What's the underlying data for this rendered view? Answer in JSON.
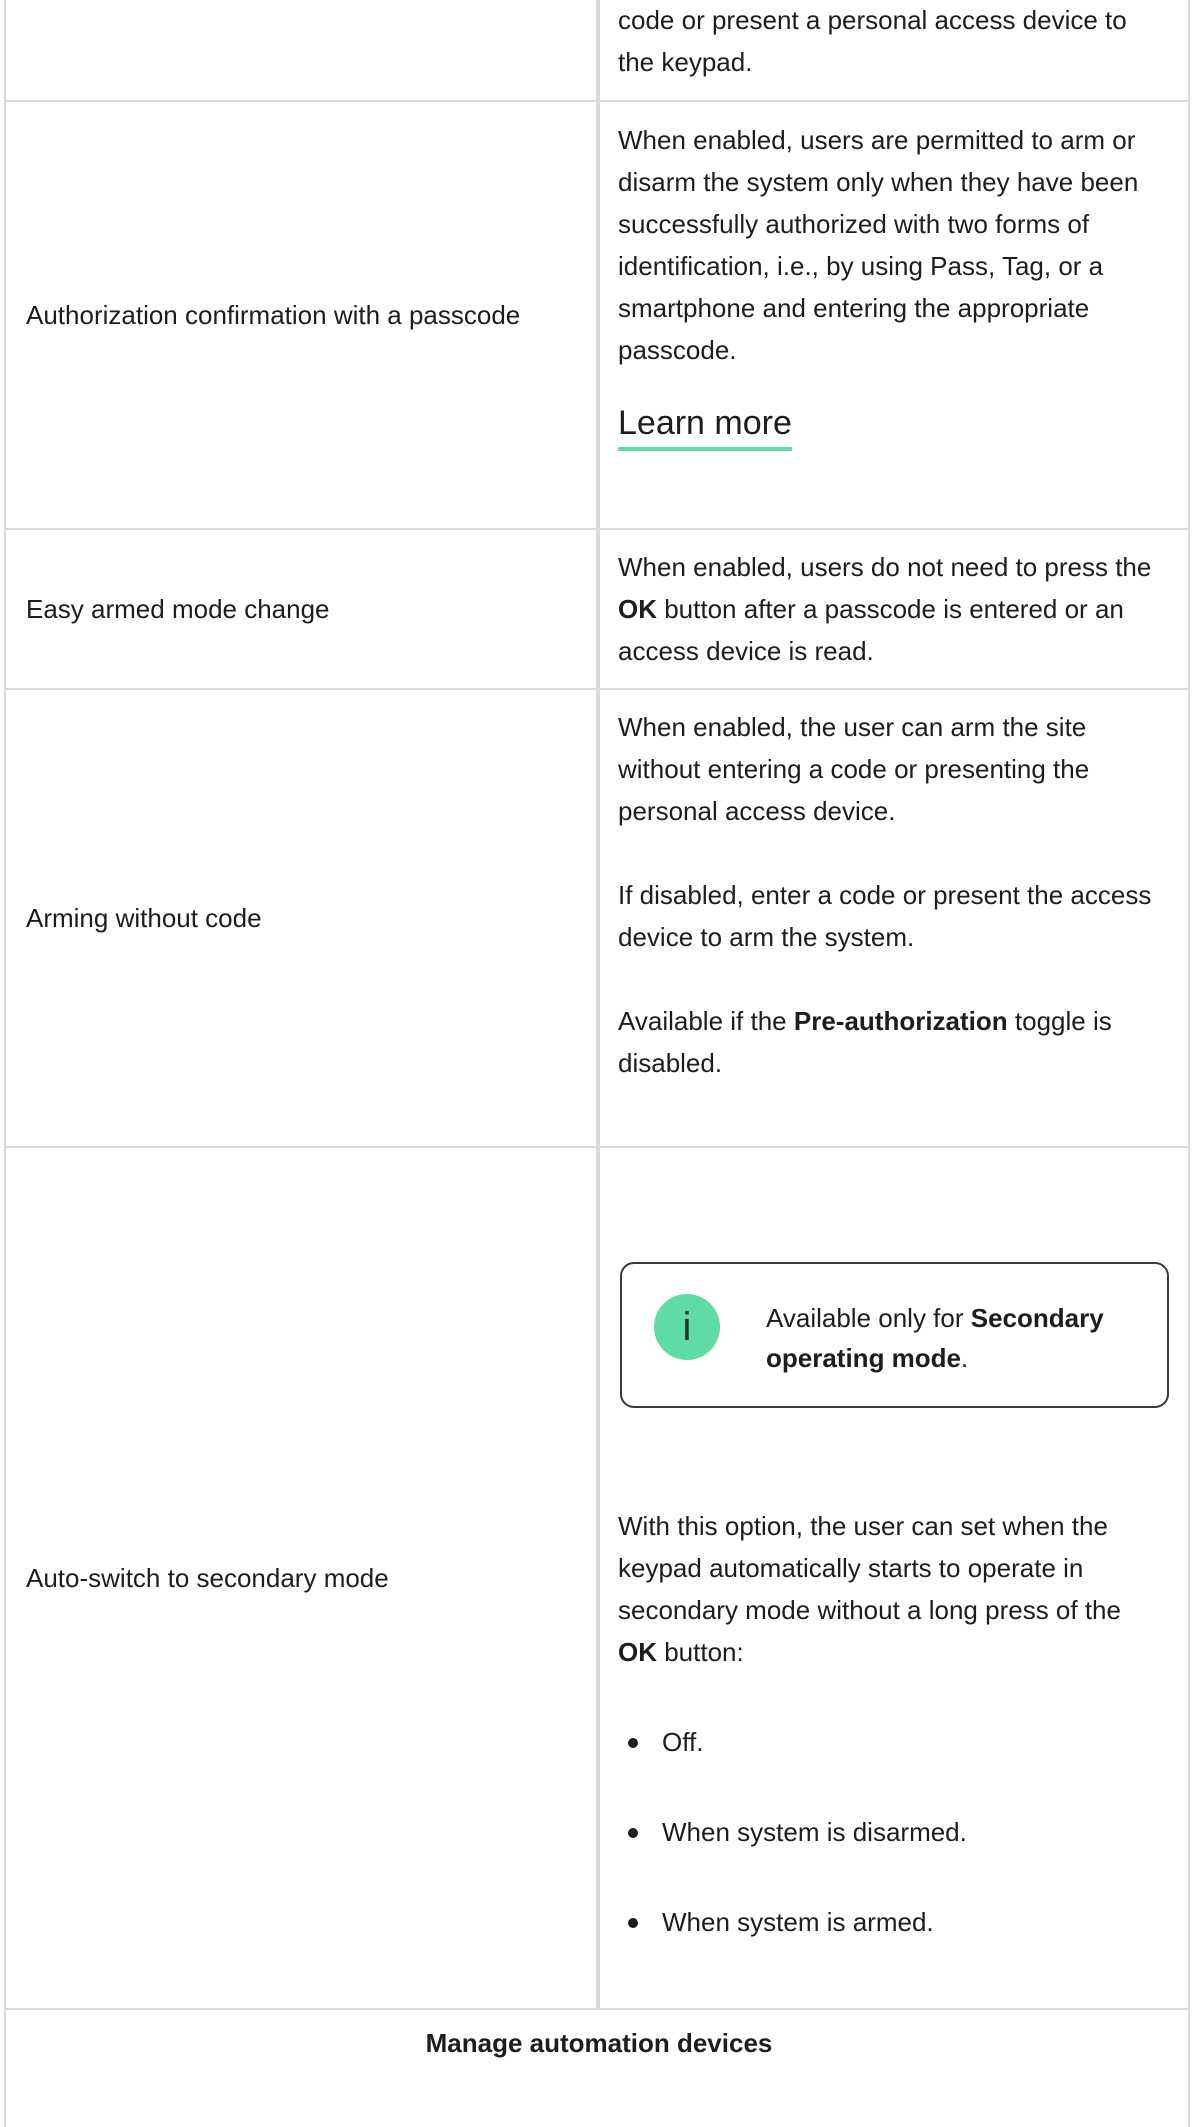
{
  "rows": {
    "top": {
      "description": [
        "code or present a personal access device to",
        "the keypad."
      ]
    },
    "auth_confirm": {
      "setting": "Authorization confirmation with a passcode",
      "description": "When enabled, users are permitted to arm or disarm the system only when they have been successfully authorized with two forms of identification, i.e., by using Pass, Tag, or a smartphone and entering the appropriate passcode.",
      "link": "Learn more"
    },
    "easy_armed": {
      "setting": "Easy armed mode change",
      "desc_before": "When enabled, users do not need to press the ",
      "desc_bold": "OK",
      "desc_after": " button after a passcode is entered or an access device is read."
    },
    "arming_without_code": {
      "setting": "Arming without code",
      "p1": "When enabled, the user can arm the site without entering a code or presenting the personal access device.",
      "p2": "If disabled, enter a code or present the access device to arm the system.",
      "p3_before": "Available if the ",
      "p3_bold": "Pre-authorization",
      "p3_after": " toggle is disabled."
    },
    "auto_switch": {
      "setting": "Auto-switch to secondary mode",
      "note_before": "Available only for ",
      "note_bold": "Secondary operating mode",
      "note_after": ".",
      "info_icon": "i",
      "desc_before": "With this option, the user can set when the keypad automatically starts to operate in secondary mode without a long press of the ",
      "desc_bold": "OK",
      "desc_after": " button:",
      "options": [
        "Off.",
        "When system is disarmed.",
        "When system is armed."
      ]
    }
  },
  "footer_heading": "Manage automation devices",
  "colors": {
    "accent": "#5fdba6",
    "border": "#d9d9d9"
  }
}
